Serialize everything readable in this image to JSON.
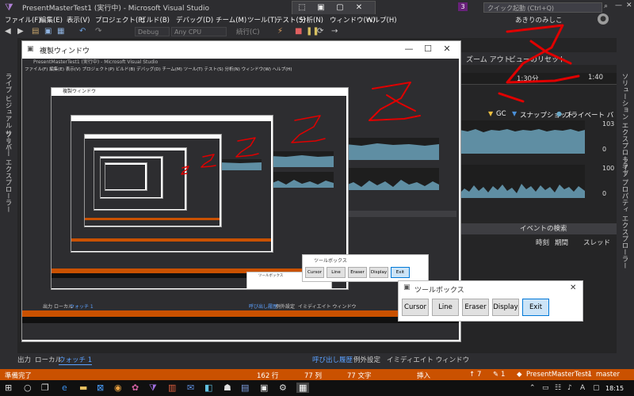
{
  "window": {
    "title": "PresentMasterTest1 (実行中) - Microsoft Visual Studio",
    "notification_count": "3",
    "quick_launch_placeholder": "クイック起動 (Ctrl+Q)",
    "user": "あきりのみしこ",
    "minimize": "—",
    "maximize": "☐",
    "close": "✕"
  },
  "menu": [
    "ファイル(F)",
    "編集(E)",
    "表示(V)",
    "プロジェクト(P)",
    "ビルド(B)",
    "デバッグ(D)",
    "チーム(M)",
    "ツール(T)",
    "テスト(S)",
    "分析(N)",
    "ウィンドウ(W)",
    "ヘルプ(H)"
  ],
  "toolbar": {
    "config": "Debug",
    "platform": "Any CPU",
    "continue": "続行(C)"
  },
  "left_tabs": [
    "ライブ ビジュアル ツリー",
    "サーバー エクスプローラー"
  ],
  "right_tabs": [
    "ソリューション エクスプローラー",
    "ライブ プロパティ エクスプローラー"
  ],
  "diagnostics": {
    "zoom_out": "ズーム アウト",
    "reset_view": "ビューのリセット",
    "time_label": "1:30分",
    "time_label_right": "1:40",
    "legend": [
      "GC",
      "スナップショット",
      "プライベート バイト"
    ],
    "y_top_1": "103",
    "y_bottom_1": "0",
    "y_top_2": "100",
    "y_bottom_2": "0",
    "events_search": "イベントの検索",
    "events_columns": [
      "時刻",
      "期間",
      "スレッド"
    ]
  },
  "bottom_tabs": {
    "left": [
      "出力",
      "ローカル",
      "ウォッチ 1"
    ],
    "right": [
      "呼び出し履歴",
      "例外設定",
      "イミディエイト ウィンドウ"
    ]
  },
  "statusbar": {
    "ready": "準備完了",
    "line": "162 行",
    "col": "77 列",
    "char": "77 文字",
    "insert": "挿入",
    "up_count": "7",
    "pen_count": "1",
    "project": "PresentMasterTest1",
    "branch": "master"
  },
  "taskbar": {
    "time": "18:15"
  },
  "duplicate_window": {
    "title": "複製ウィンドウ"
  },
  "toolbox": {
    "title": "ツールボックス",
    "buttons": [
      "Cursor",
      "Line",
      "Eraser",
      "Display",
      "Exit"
    ]
  },
  "colors": {
    "accent": "#68217a",
    "status": "#ca5100",
    "exit_button": "#cce4f7",
    "ink": "#e00000"
  }
}
